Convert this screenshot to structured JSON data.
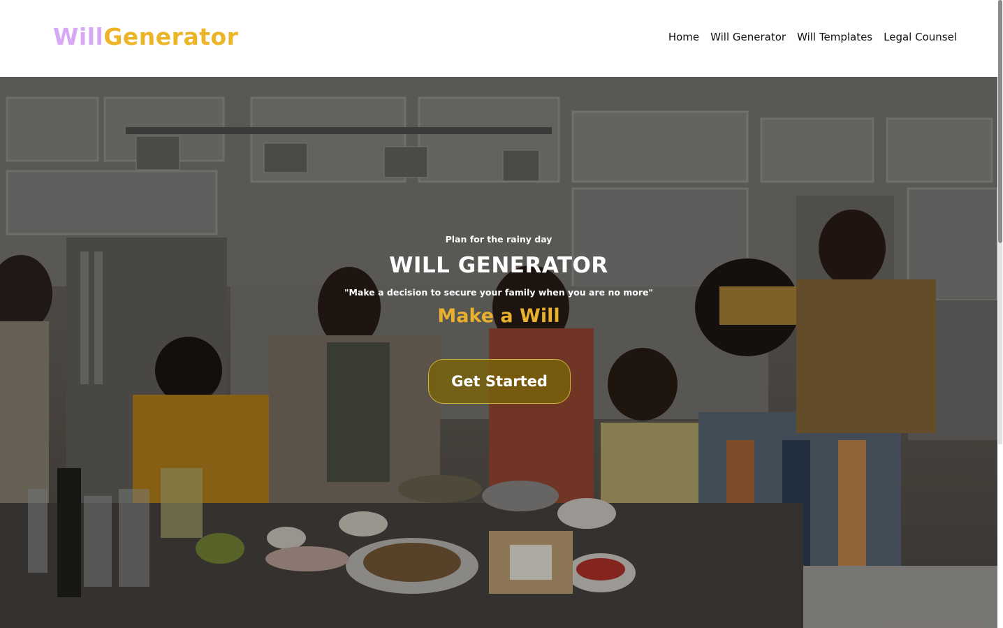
{
  "logo": {
    "part1": "Will",
    "part2": "Generator"
  },
  "nav": {
    "home": "Home",
    "will_generator": "Will Generator",
    "will_templates": "Will Templates",
    "legal_counsel": "Legal Counsel"
  },
  "hero": {
    "tagline": "Plan for the rainy day",
    "title": "WILL GENERATOR",
    "quote": "\"Make a decision to secure your family when you are no more\"",
    "cta_text": "Make a Will",
    "button_label": "Get Started"
  },
  "colors": {
    "logo_purple": "#d6a8f6",
    "logo_gold": "#ecb528",
    "cta_gold": "#e9b12d",
    "button_bg": "#786410"
  }
}
